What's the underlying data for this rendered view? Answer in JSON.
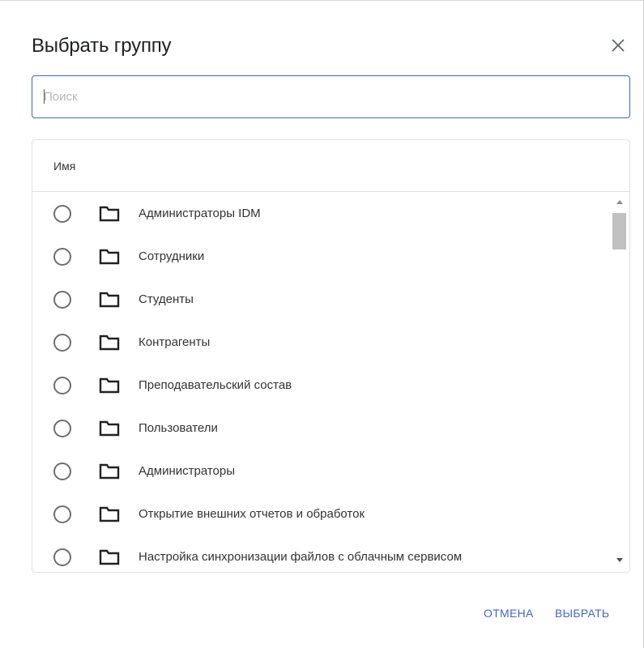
{
  "dialog": {
    "title": "Выбрать группу",
    "close_icon": "close-icon"
  },
  "search": {
    "placeholder": "Поиск",
    "value": ""
  },
  "table": {
    "column_header": "Имя",
    "rows": [
      {
        "label": "Администраторы IDM",
        "selected": false,
        "icon": "folder-icon"
      },
      {
        "label": "Сотрудники",
        "selected": false,
        "icon": "folder-icon"
      },
      {
        "label": "Студенты",
        "selected": false,
        "icon": "folder-icon"
      },
      {
        "label": "Контрагенты",
        "selected": false,
        "icon": "folder-icon"
      },
      {
        "label": "Преподавательский состав",
        "selected": false,
        "icon": "folder-icon"
      },
      {
        "label": "Пользователи",
        "selected": false,
        "icon": "folder-icon"
      },
      {
        "label": "Администраторы",
        "selected": false,
        "icon": "folder-icon"
      },
      {
        "label": "Открытие внешних отчетов и обработок",
        "selected": false,
        "icon": "folder-icon"
      },
      {
        "label": "Настройка синхронизации файлов с облачным сервисом",
        "selected": false,
        "icon": "folder-icon"
      }
    ]
  },
  "actions": {
    "cancel_label": "ОТМЕНА",
    "select_label": "ВЫБРАТЬ"
  },
  "colors": {
    "accent": "#4466c9",
    "text": "#333333",
    "border": "#e0e0e0"
  }
}
